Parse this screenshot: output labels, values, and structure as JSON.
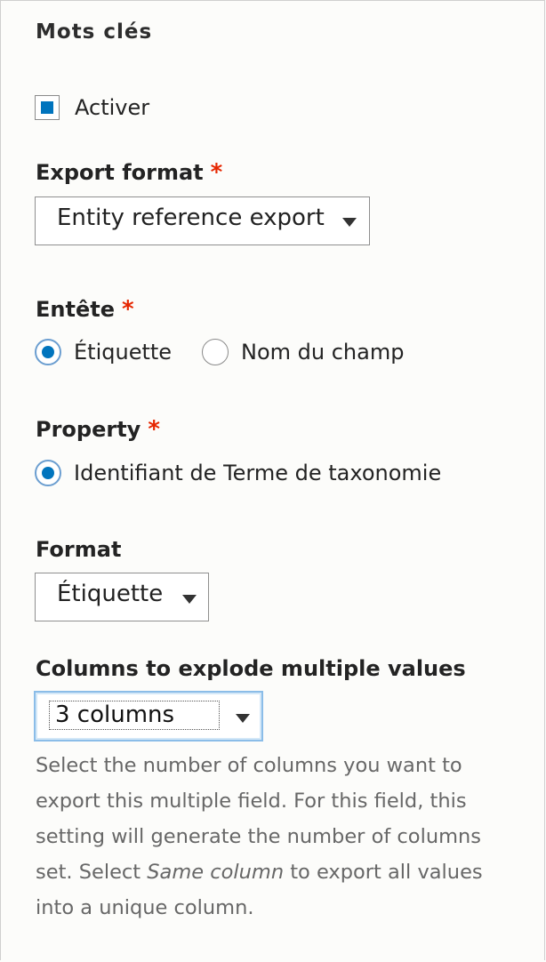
{
  "fieldset": {
    "title": "Mots clés"
  },
  "enable": {
    "label": "Activer",
    "checked": true
  },
  "export_format": {
    "label": "Export format",
    "required_marker": "*",
    "selected": "Entity reference export"
  },
  "header": {
    "label": "Entête",
    "required_marker": "*",
    "options": [
      {
        "label": "Étiquette",
        "checked": true
      },
      {
        "label": "Nom du champ",
        "checked": false
      }
    ]
  },
  "property": {
    "label": "Property",
    "required_marker": "*",
    "options": [
      {
        "label": "Identifiant de Terme de taxonomie",
        "checked": true
      }
    ]
  },
  "format": {
    "label": "Format",
    "selected": "Étiquette"
  },
  "explode_columns": {
    "label": "Columns to explode multiple values",
    "selected": "3 columns",
    "description_before": "Select the number of columns you want to export this multiple field. For this field, this setting will generate the number of columns set. Select ",
    "description_emphasis": "Same column",
    "description_after": " to export all values into a unique column."
  },
  "colors": {
    "accent": "#0074bd",
    "required": "#e62600",
    "focus": "#8bbde8"
  }
}
